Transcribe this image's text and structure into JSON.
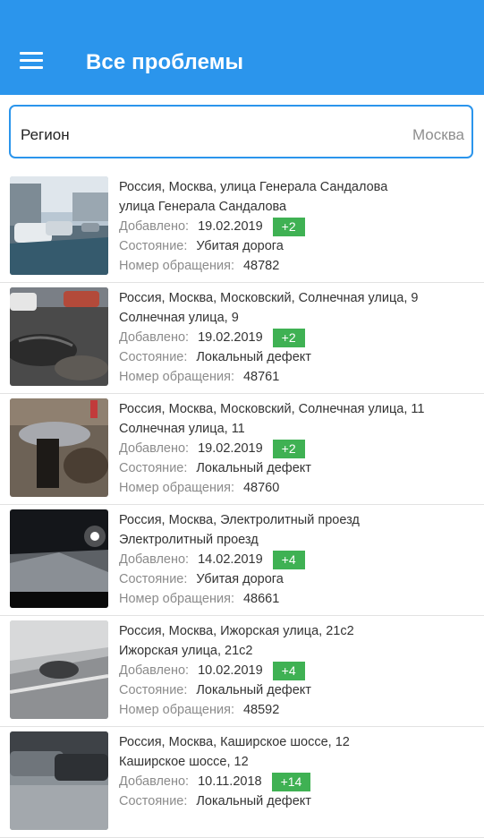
{
  "appbar": {
    "title": "Все проблемы",
    "menu_icon": "hamburger-menu-icon"
  },
  "region": {
    "label": "Регион",
    "value": "Москва"
  },
  "labels": {
    "added": "Добавлено:",
    "state": "Состояние:",
    "number": "Номер обращения:"
  },
  "colors": {
    "primary": "#2b95ec",
    "badge": "#3fb153"
  },
  "problems": [
    {
      "address": "Россия, Москва, улица Генерала Сандалова",
      "street": "улица Генерала Сандалова",
      "date": "19.02.2019",
      "votes": "+2",
      "state": "Убитая дорога",
      "number": "48782"
    },
    {
      "address": "Россия, Москва, Московский, Солнечная улица, 9",
      "street": "Солнечная улица, 9",
      "date": "19.02.2019",
      "votes": "+2",
      "state": "Локальный дефект",
      "number": "48761"
    },
    {
      "address": "Россия, Москва, Московский, Солнечная улица, 11",
      "street": "Солнечная улица, 11",
      "date": "19.02.2019",
      "votes": "+2",
      "state": "Локальный дефект",
      "number": "48760"
    },
    {
      "address": "Россия, Москва, Электролитный проезд",
      "street": "Электролитный проезд",
      "date": "14.02.2019",
      "votes": "+4",
      "state": "Убитая дорога",
      "number": "48661"
    },
    {
      "address": "Россия, Москва, Ижорская улица, 21с2",
      "street": "Ижорская улица, 21с2",
      "date": "10.02.2019",
      "votes": "+4",
      "state": "Локальный дефект",
      "number": "48592"
    },
    {
      "address": "Россия, Москва, Каширское шоссе, 12",
      "street": "Каширское шоссе, 12",
      "date": "10.11.2018",
      "votes": "+14",
      "state": "Локальный дефект",
      "number": ""
    }
  ]
}
